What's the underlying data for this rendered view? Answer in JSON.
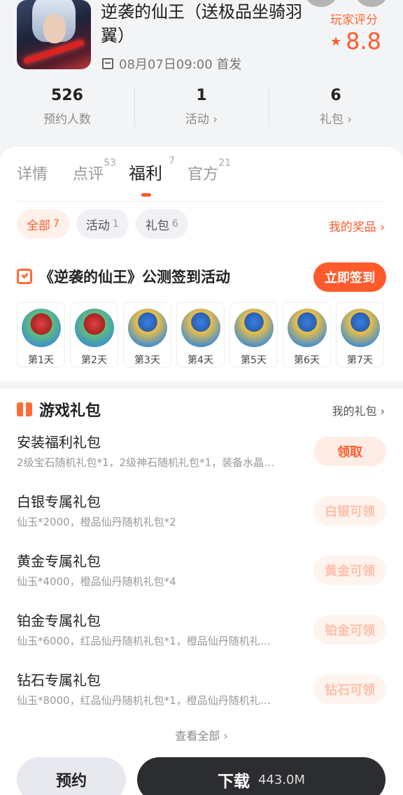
{
  "header": {
    "title": "逆袭的仙王（送极品坐骑羽翼）",
    "release": "08月07日09:00 首发",
    "rating_label": "玩家评分",
    "rating": "8.8"
  },
  "stats": [
    {
      "num": "526",
      "label": "预约人数"
    },
    {
      "num": "1",
      "label": "活动 ›"
    },
    {
      "num": "6",
      "label": "礼包 ›"
    }
  ],
  "tabs": [
    {
      "label": "详情",
      "count": ""
    },
    {
      "label": "点评",
      "count": "53"
    },
    {
      "label": "福利",
      "count": "7"
    },
    {
      "label": "官方",
      "count": "21"
    }
  ],
  "chips": [
    {
      "label": "全部",
      "count": "7"
    },
    {
      "label": "活动",
      "count": "1"
    },
    {
      "label": "礼包",
      "count": "6"
    }
  ],
  "my_prizes": "我的奖品 ›",
  "checkin": {
    "title": "《逆袭的仙王》公测签到活动",
    "button": "立即签到",
    "days": [
      "第1天",
      "第2天",
      "第3天",
      "第4天",
      "第5天",
      "第6天",
      "第7天"
    ]
  },
  "gifts": {
    "title": "游戏礼包",
    "my_gifts": "我的礼包 ›",
    "items": [
      {
        "name": "安装福利礼包",
        "desc": "2级宝石随机礼包*1，2级神石随机礼包*1，装备水晶…",
        "button": "领取"
      },
      {
        "name": "白银专属礼包",
        "desc": "仙玉*2000，橙品仙丹随机礼包*2",
        "button": "白银可领"
      },
      {
        "name": "黄金专属礼包",
        "desc": "仙玉*4000，橙品仙丹随机礼包*4",
        "button": "黄金可领"
      },
      {
        "name": "铂金专属礼包",
        "desc": "仙玉*6000，红品仙丹随机礼包*1，橙品仙丹随机礼…",
        "button": "铂金可领"
      },
      {
        "name": "钻石专属礼包",
        "desc": "仙玉*8000，红品仙丹随机礼包*1，橙品仙丹随机礼…",
        "button": "钻石可领"
      }
    ]
  },
  "view_all": "查看全部 ›",
  "bottom": {
    "reserve": "预约",
    "download": "下载",
    "size": "443.0M"
  },
  "colors": {
    "accent": "#ff5a2c",
    "dark_button": "#2c2d30"
  }
}
